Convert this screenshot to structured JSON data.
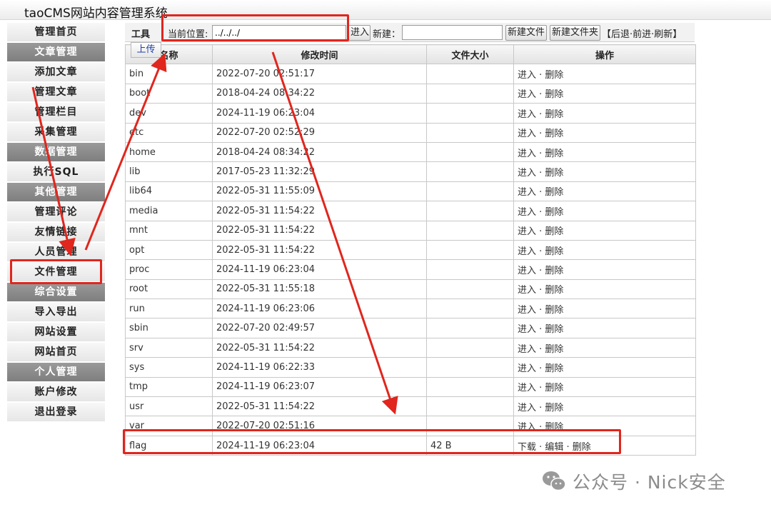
{
  "app": {
    "title": "taoCMS网站内容管理系统"
  },
  "sidebar": {
    "items": [
      {
        "label": "管理首页",
        "type": "link"
      },
      {
        "label": "文章管理",
        "type": "group"
      },
      {
        "label": "添加文章",
        "type": "link"
      },
      {
        "label": "管理文章",
        "type": "link"
      },
      {
        "label": "管理栏目",
        "type": "link"
      },
      {
        "label": "采集管理",
        "type": "link"
      },
      {
        "label": "数据管理",
        "type": "group"
      },
      {
        "label": "执行SQL",
        "type": "link"
      },
      {
        "label": "其他管理",
        "type": "group"
      },
      {
        "label": "管理评论",
        "type": "link"
      },
      {
        "label": "友情链接",
        "type": "link"
      },
      {
        "label": "人员管理",
        "type": "link"
      },
      {
        "label": "文件管理",
        "type": "link"
      },
      {
        "label": "综合设置",
        "type": "group"
      },
      {
        "label": "导入导出",
        "type": "link"
      },
      {
        "label": "网站设置",
        "type": "link"
      },
      {
        "label": "网站首页",
        "type": "link"
      },
      {
        "label": "个人管理",
        "type": "group"
      },
      {
        "label": "账户修改",
        "type": "link"
      },
      {
        "label": "退出登录",
        "type": "link"
      }
    ]
  },
  "toolbar": {
    "tools_label": "工具",
    "location_label": "当前位置:",
    "location_value": "../../../",
    "enter_button": "进入",
    "new_label": "新建：",
    "new_value": "",
    "new_file_button": "新建文件",
    "new_folder_button": "新建文件夹",
    "nav_links": "【后退·前进·刷新】"
  },
  "upload_tab": "上传",
  "table": {
    "headers": [
      "名称",
      "修改时间",
      "文件大小",
      "操作"
    ],
    "rows": [
      {
        "name": "bin",
        "mtime": "2022-07-20 02:51:17",
        "size": "",
        "actions": "进入 · 删除"
      },
      {
        "name": "boot",
        "mtime": "2018-04-24 08:34:22",
        "size": "",
        "actions": "进入 · 删除"
      },
      {
        "name": "dev",
        "mtime": "2024-11-19 06:23:04",
        "size": "",
        "actions": "进入 · 删除"
      },
      {
        "name": "etc",
        "mtime": "2022-07-20 02:52:29",
        "size": "",
        "actions": "进入 · 删除"
      },
      {
        "name": "home",
        "mtime": "2018-04-24 08:34:22",
        "size": "",
        "actions": "进入 · 删除"
      },
      {
        "name": "lib",
        "mtime": "2017-05-23 11:32:29",
        "size": "",
        "actions": "进入 · 删除"
      },
      {
        "name": "lib64",
        "mtime": "2022-05-31 11:55:09",
        "size": "",
        "actions": "进入 · 删除"
      },
      {
        "name": "media",
        "mtime": "2022-05-31 11:54:22",
        "size": "",
        "actions": "进入 · 删除"
      },
      {
        "name": "mnt",
        "mtime": "2022-05-31 11:54:22",
        "size": "",
        "actions": "进入 · 删除"
      },
      {
        "name": "opt",
        "mtime": "2022-05-31 11:54:22",
        "size": "",
        "actions": "进入 · 删除"
      },
      {
        "name": "proc",
        "mtime": "2024-11-19 06:23:04",
        "size": "",
        "actions": "进入 · 删除"
      },
      {
        "name": "root",
        "mtime": "2022-05-31 11:55:18",
        "size": "",
        "actions": "进入 · 删除"
      },
      {
        "name": "run",
        "mtime": "2024-11-19 06:23:06",
        "size": "",
        "actions": "进入 · 删除"
      },
      {
        "name": "sbin",
        "mtime": "2022-07-20 02:49:57",
        "size": "",
        "actions": "进入 · 删除"
      },
      {
        "name": "srv",
        "mtime": "2022-05-31 11:54:22",
        "size": "",
        "actions": "进入 · 删除"
      },
      {
        "name": "sys",
        "mtime": "2024-11-19 06:22:33",
        "size": "",
        "actions": "进入 · 删除"
      },
      {
        "name": "tmp",
        "mtime": "2024-11-19 06:23:07",
        "size": "",
        "actions": "进入 · 删除"
      },
      {
        "name": "usr",
        "mtime": "2022-05-31 11:54:22",
        "size": "",
        "actions": "进入 · 删除"
      },
      {
        "name": "var",
        "mtime": "2022-07-20 02:51:16",
        "size": "",
        "actions": "进入 · 删除"
      },
      {
        "name": "flag",
        "mtime": "2024-11-19 06:23:04",
        "size": "42 B",
        "actions": "下载 · 编辑 · 删除"
      }
    ]
  },
  "annotation": {
    "color": "#e0261d"
  },
  "watermark": {
    "text": "公众号 · Nick安全",
    "icon": "wechat-icon"
  }
}
